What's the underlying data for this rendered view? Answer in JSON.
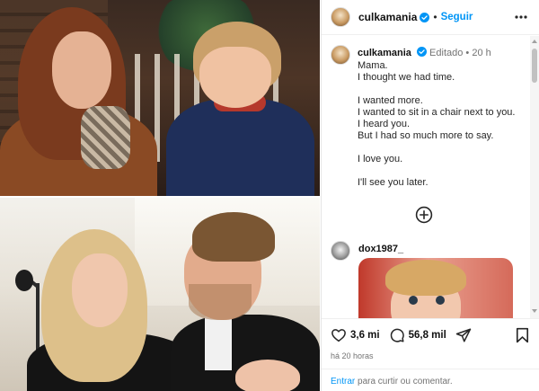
{
  "post": {
    "username": "culkamania",
    "follow_label": "Seguir",
    "separator": "•",
    "caption": {
      "username": "culkamania",
      "edited_label": "Editado",
      "dot": "•",
      "age": "20 h",
      "lines": {
        "l1": "Mama.",
        "l2": "I thought we had time.",
        "l3": "I wanted more.",
        "l4": "I wanted to sit in a chair next to you.",
        "l5": "I heard you.",
        "l6": "But I had so much more to say.",
        "l7": "I love you.",
        "l8": "I'll see you later."
      }
    },
    "comment": {
      "username": "dox1987_"
    },
    "stats": {
      "likes": "3,6 mi",
      "comments": "56,8 mil"
    },
    "timestamp": "há 20 horas",
    "login_prompt": {
      "link": "Entrar",
      "rest": " para curtir ou comentar."
    }
  },
  "icons": {
    "verified": "verified-badge-icon",
    "more": "more-horizontal-icon",
    "add": "plus-circle-icon",
    "like": "heart-icon",
    "comment": "comment-bubble-icon",
    "share": "share-paper-plane-icon",
    "save": "bookmark-icon"
  },
  "colors": {
    "link": "#0095f6",
    "verified": "#0095f6",
    "muted": "#737373"
  }
}
